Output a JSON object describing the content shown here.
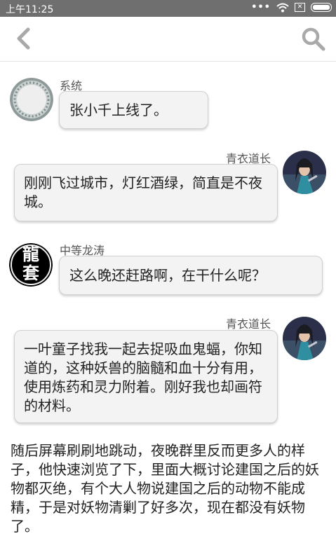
{
  "status_bar": {
    "time": "上午11:25",
    "dots": "•••"
  },
  "messages": [
    {
      "sender": "系统",
      "text": "张小千上线了。",
      "avatar": "mirror-avatar"
    },
    {
      "sender": "青衣道长",
      "text": "刚刚飞过城市，灯红酒绿，简直是不夜城。",
      "avatar": "taoist-avatar"
    },
    {
      "sender": "中等龙涛",
      "text": "这么晚还赶路啊，在干什么呢？",
      "avatar": "dragon-avatar",
      "avatar_text": "龍套"
    },
    {
      "sender": "青衣道长",
      "text": "一叶童子找我一起去捉吸血鬼蝠，你知道的，这种妖兽的脑髓和血十分有用，使用炼药和灵力附着。刚好我也却画符的材料。",
      "avatar": "taoist-avatar"
    }
  ],
  "narration": "随后屏幕刷刷地跳动，夜晚群里反而更多人的样子，他快速浏览了下，里面大概讨论建国之后的妖物都灭绝，有个大人物说建国之后的动物不能成精，于是对妖物清剿了好多次，现在都没有妖物了。"
}
